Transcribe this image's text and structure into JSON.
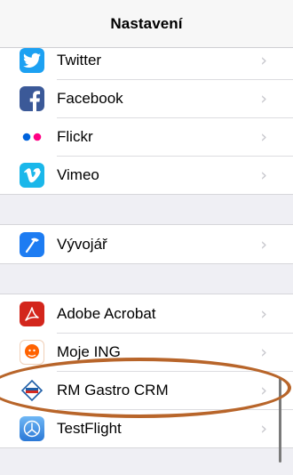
{
  "navbar": {
    "title": "Nastavení"
  },
  "groups": [
    [
      {
        "label": "Twitter",
        "icon": "twitter-icon",
        "color": "#1da1f2"
      },
      {
        "label": "Facebook",
        "icon": "facebook-icon",
        "color": "#3b5998"
      },
      {
        "label": "Flickr",
        "icon": "flickr-icon",
        "color": "#ffffff"
      },
      {
        "label": "Vimeo",
        "icon": "vimeo-icon",
        "color": "#1ab7ea"
      }
    ],
    [
      {
        "label": "Vývojář",
        "icon": "hammer-icon",
        "color": "#1d7cf2"
      }
    ],
    [
      {
        "label": "Adobe Acrobat",
        "icon": "acrobat-icon",
        "color": "#d3261c"
      },
      {
        "label": "Moje ING",
        "icon": "ing-lion-icon",
        "color": "#ff6200"
      },
      {
        "label": "RM Gastro CRM",
        "icon": "rm-gastro-logo-icon",
        "color": "#ffffff"
      },
      {
        "label": "TestFlight",
        "icon": "testflight-icon",
        "color": "#3a8fe0"
      }
    ]
  ],
  "chevron": "›"
}
